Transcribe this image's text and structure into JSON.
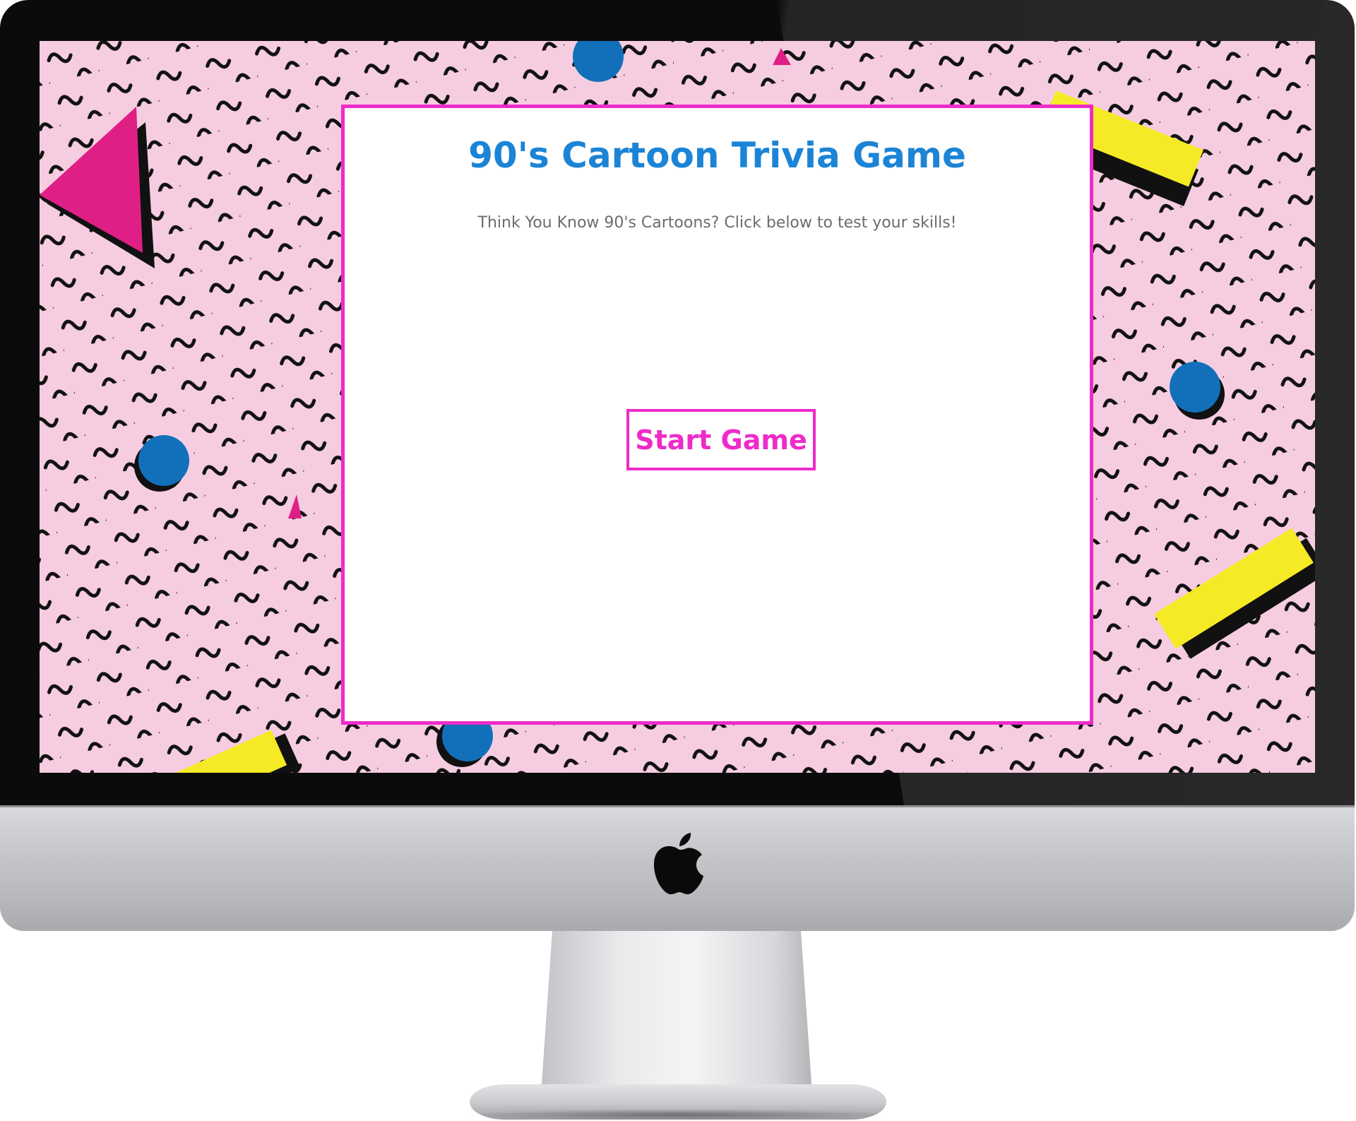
{
  "page": {
    "title": "90's Cartoon Trivia Game",
    "subtitle": "Think You Know 90's Cartoons? Click below to test your skills!",
    "start_button_label": "Start Game"
  },
  "colors": {
    "accent_pink": "#ee2bc9",
    "title_blue": "#1b84d6",
    "background_pink": "#f6cde0",
    "shape_blue": "#1270ba",
    "shape_yellow": "#f5ea25",
    "shape_magenta": "#e01f86",
    "subtitle_gray": "#6c6c6c"
  },
  "decor": {
    "background_pattern": "90s memphis squiggle pattern",
    "device": "imac-monitor",
    "logo_icon": "apple-logo-icon"
  }
}
